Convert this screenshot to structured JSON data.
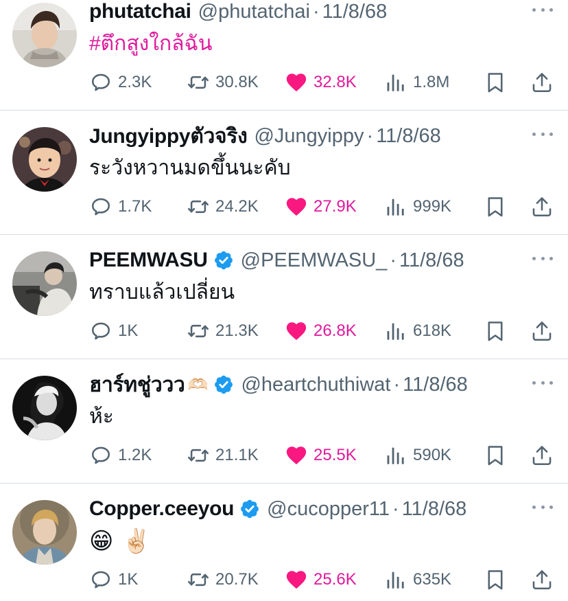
{
  "tweets": [
    {
      "name": "phutatchai",
      "name_emoji": "",
      "verified": false,
      "handle": "@phutatchai",
      "date": "11/8/68",
      "text": "#ตึกสูงใกล้ฉัน",
      "text_is_hashtag": true,
      "emojis": [],
      "replies": "2.3K",
      "retweets": "30.8K",
      "likes": "32.8K",
      "views": "1.8M"
    },
    {
      "name": "Jungyippyตัวจริง",
      "name_emoji": "",
      "verified": false,
      "handle": "@Jungyippy",
      "date": "11/8/68",
      "text": "ระวังหวานมดขึ้นนะคับ",
      "text_is_hashtag": false,
      "emojis": [],
      "replies": "1.7K",
      "retweets": "24.2K",
      "likes": "27.9K",
      "views": "999K"
    },
    {
      "name": "PEEMWASU",
      "name_emoji": "",
      "verified": true,
      "handle": "@PEEMWASU_",
      "date": "11/8/68",
      "text": "ทราบแล้วเปลี่ยน",
      "text_is_hashtag": false,
      "emojis": [],
      "replies": "1K",
      "retweets": "21.3K",
      "likes": "26.8K",
      "views": "618K"
    },
    {
      "name": "ฮาร์ทชู่ววว",
      "name_emoji": "🫶🏻",
      "verified": true,
      "handle": "@heartchuthiwat",
      "date": "11/8/68",
      "text": "ห้ะ",
      "text_is_hashtag": false,
      "emojis": [],
      "replies": "1.2K",
      "retweets": "21.1K",
      "likes": "25.5K",
      "views": "590K"
    },
    {
      "name": "Copper.ceeyou",
      "name_emoji": "",
      "verified": true,
      "handle": "@cucopper11",
      "date": "11/8/68",
      "text": "",
      "text_is_hashtag": false,
      "emojis": [
        "😁",
        "✌🏻"
      ],
      "replies": "1K",
      "retweets": "20.7K",
      "likes": "25.6K",
      "views": "635K"
    }
  ],
  "colors": {
    "like": "#e0199c",
    "verified": "#1d9bf0",
    "muted": "#536471",
    "text": "#0f1419",
    "divider": "#d6dbe0"
  },
  "icons": {
    "reply": "reply-bubble-icon",
    "retweet": "retweet-arrows-icon",
    "like": "heart-filled-icon",
    "views": "bar-chart-icon",
    "bookmark": "bookmark-icon",
    "share": "share-upload-icon",
    "more": "more-dots-icon",
    "verified": "verified-badge-icon"
  },
  "sep": "·"
}
